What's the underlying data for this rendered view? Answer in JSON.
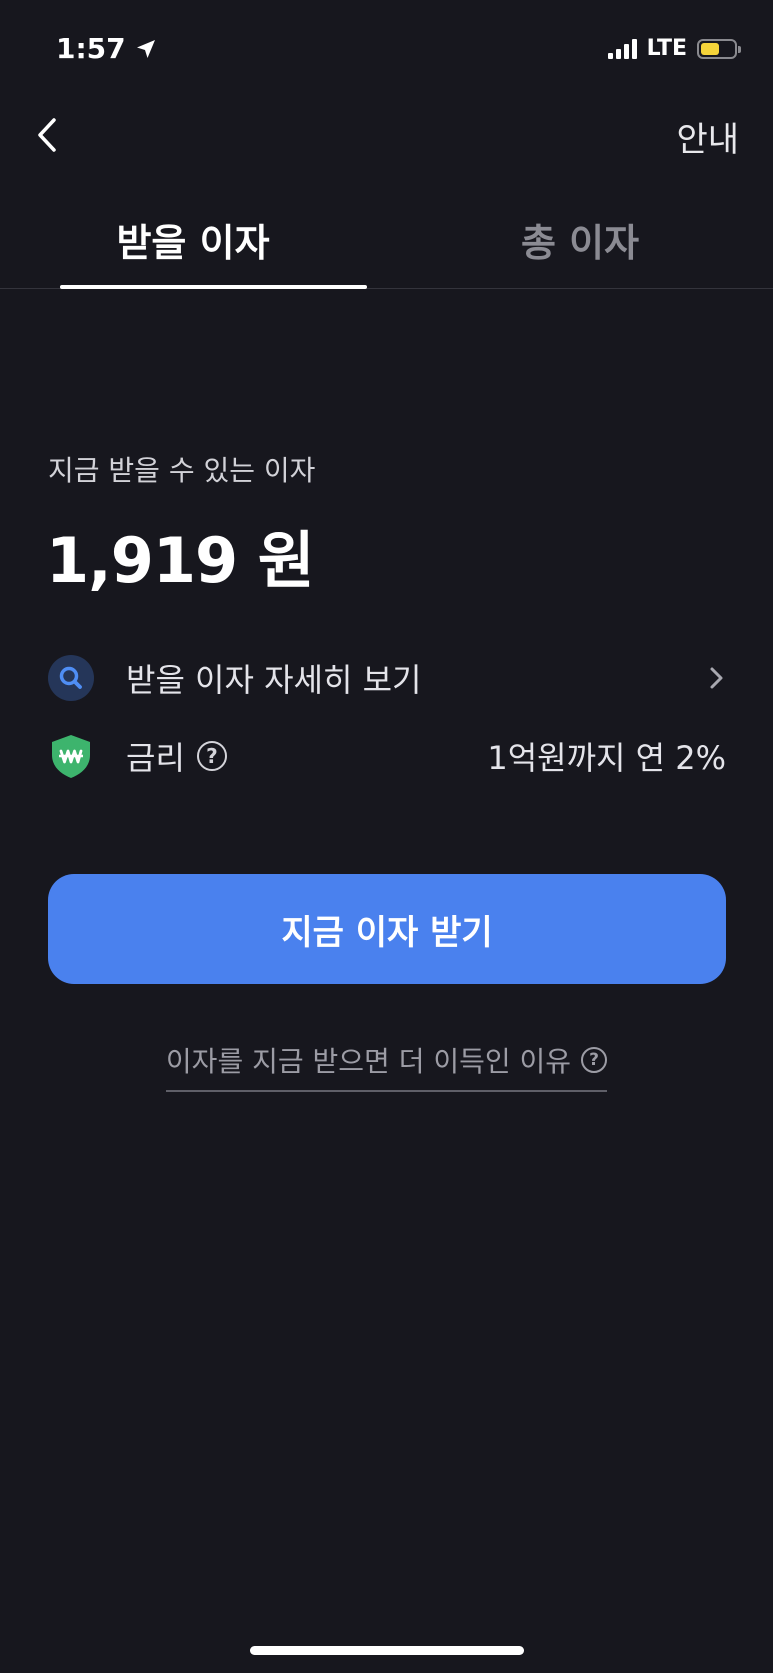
{
  "status_bar": {
    "time": "1:57",
    "network": "LTE",
    "battery_level": 0.55
  },
  "header": {
    "info_label": "안내"
  },
  "tabs": [
    {
      "label": "받을 이자",
      "active": true
    },
    {
      "label": "총 이자",
      "active": false
    }
  ],
  "balance": {
    "label": "지금 받을 수 있는 이자",
    "amount": "1,919 원"
  },
  "detail_row": {
    "label": "받을 이자 자세히 보기"
  },
  "rate_row": {
    "label": "금리",
    "value": "1억원까지 연 2%"
  },
  "primary_button": {
    "label": "지금 이자 받기"
  },
  "reason_link": {
    "label": "이자를 지금 받으면 더 이득인 이유"
  },
  "colors": {
    "background": "#17171e",
    "accent": "#4a81ee",
    "shield": "#3db46d"
  }
}
